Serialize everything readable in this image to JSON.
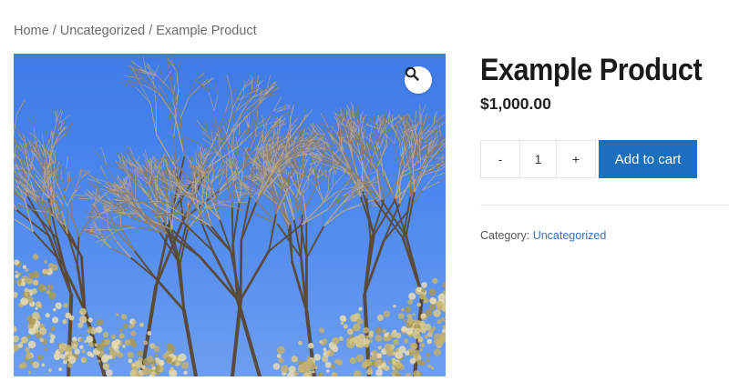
{
  "breadcrumb": {
    "items": [
      "Home",
      "Uncategorized",
      "Example Product"
    ],
    "separator": "/"
  },
  "product": {
    "title": "Example Product",
    "price": "$1,000.00",
    "image_alt": "bare winter trees against blue sky"
  },
  "quantity": {
    "minus_label": "-",
    "value": "1",
    "plus_label": "+"
  },
  "cart": {
    "add_label": "Add to cart"
  },
  "meta": {
    "category_label": "Category:",
    "category_value": "Uncategorized"
  },
  "icons": {
    "zoom": "magnifier-icon"
  },
  "colors": {
    "button_bg": "#1c6fbe",
    "link": "#3d6fb6",
    "sky": "#4a86ee"
  }
}
